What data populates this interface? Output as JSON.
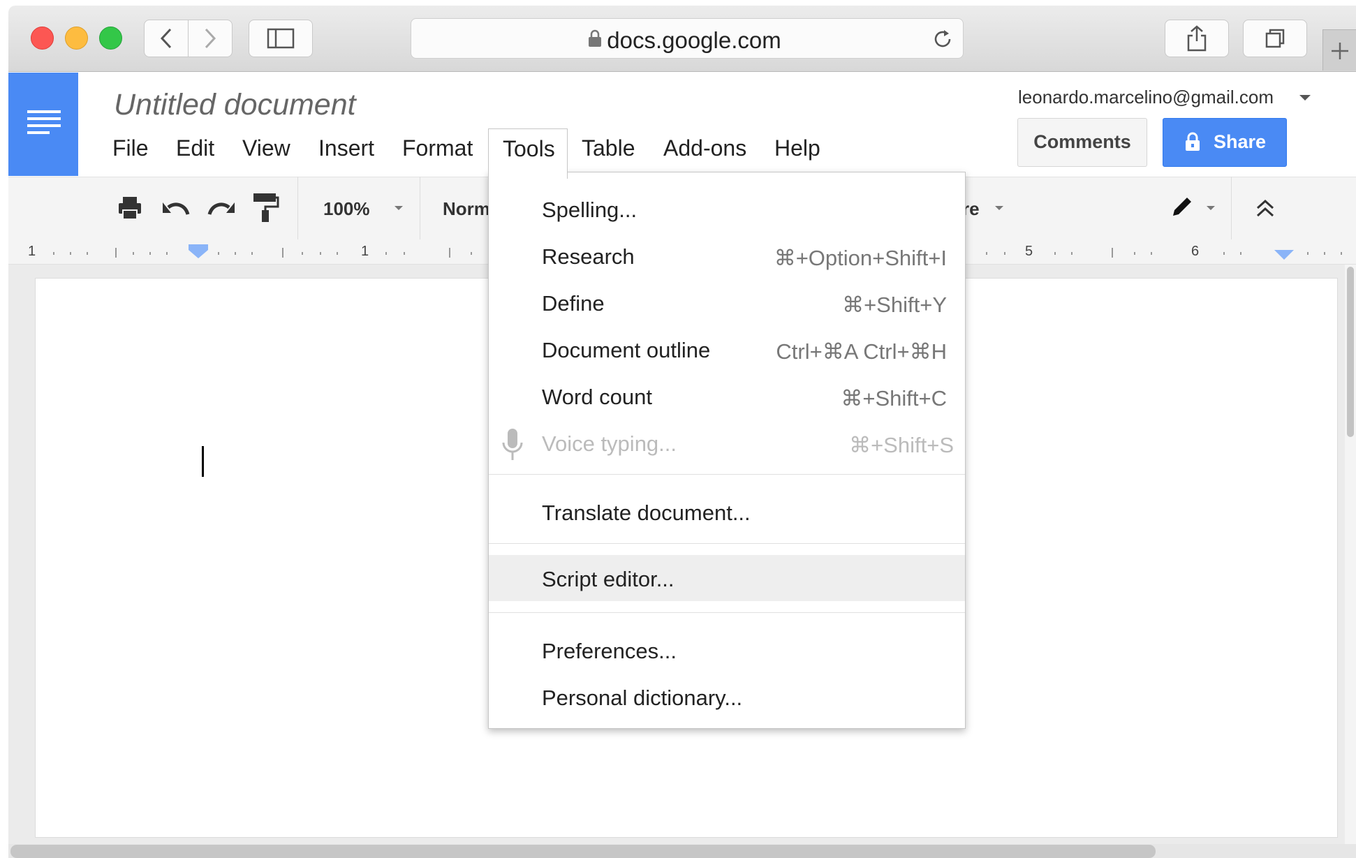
{
  "browser": {
    "url": "docs.google.com",
    "colors": {
      "close": "#fc5753",
      "minimize": "#fdbc40",
      "zoom": "#33c748"
    }
  },
  "document": {
    "title": "Untitled document",
    "account": "leonardo.marcelino@gmail.com",
    "comments_label": "Comments",
    "share_label": "Share",
    "accent": "#4a8af4"
  },
  "menubar": [
    "File",
    "Edit",
    "View",
    "Insert",
    "Format",
    "Tools",
    "Table",
    "Add-ons",
    "Help"
  ],
  "toolbar": {
    "zoom": "100%",
    "style": "Norm",
    "font_fragment": "re"
  },
  "ruler": {
    "labels": [
      "1",
      "1",
      "5",
      "6"
    ]
  },
  "tools_menu": {
    "items": [
      {
        "label": "Spelling...",
        "shortcut": ""
      },
      {
        "label": "Research",
        "shortcut": "⌘+Option+Shift+I"
      },
      {
        "label": "Define",
        "shortcut": "⌘+Shift+Y"
      },
      {
        "label": "Document outline",
        "shortcut": "Ctrl+⌘A Ctrl+⌘H"
      },
      {
        "label": "Word count",
        "shortcut": "⌘+Shift+C"
      },
      {
        "label": "Voice typing...",
        "shortcut": "⌘+Shift+S",
        "disabled": true,
        "icon": "microphone-icon"
      },
      {
        "label": "Translate document...",
        "shortcut": ""
      },
      {
        "label": "Script editor...",
        "shortcut": "",
        "highlighted": true
      },
      {
        "label": "Preferences...",
        "shortcut": ""
      },
      {
        "label": "Personal dictionary...",
        "shortcut": ""
      }
    ]
  }
}
